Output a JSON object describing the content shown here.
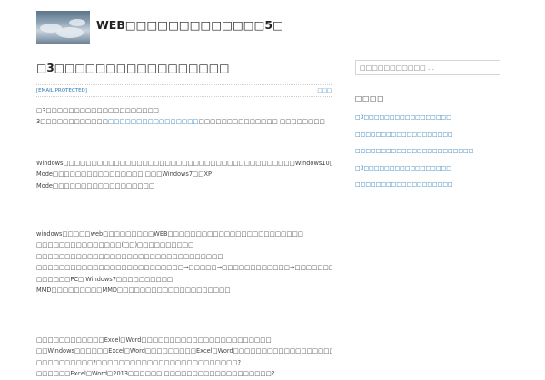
{
  "site": {
    "title": "WEB□□□□□□□□□□□□□5□",
    "logo_icon": "sky-clouds-logo"
  },
  "post": {
    "title": "□3□□□□□□□□□□□□□□□□□",
    "email": "[EMAIL PROTECTED]",
    "meta_right": "□□□",
    "paragraphs": [
      {
        "pre": "□3□□□□□□□□□□□□□□□□□□□□ 3□□□□□□□□□□□□",
        "link": "□□□□□□□□□□□□□□□□",
        "post": "□□□□□□□□□□□□□□ □□□□□□□□ □ 2□□□□□□□□□□□□□□□□□□□□□□□□□□□ □□□□□□□□□□□□1□□□□□"
      },
      {
        "text": "Windows□□□□□□□□□□□□□□□□□□□□□□□□□□□□□□□□□□□□□□□□□Windows10□□XP Mode□□□□□□□□□□□□□□□□ □□□Windows7□□XP Mode□□□□□□□□□□□□□□□□□□ Windows7□□2020□□□□□□□□□□□□□□□□□□□□□□□□□□□□□ □□□□□□□□□□□ □□□□□□□□□□□□□□□□□□□□□□□□□? □□□□□□□□□□□□□"
      },
      {
        "text": "windows□□□□□web□□□□□□□□□WEB□□□□□□□□□□□□□□□□□□□□□□□□ □□□□□□□□□□□□□□□(□□)□□□□□□□□□□ □□□□□□□□□□□□□□□□□□□□□□□□□□□□□□□□□ □□□□□□□□□□□□□□□□□□□□□□□□□□→□□□□□→□□□□□□□□□□□□→□□□□□□□□□□□□□□□□□□□□□□□□□□□□□□□□□□□□□□□□□□□□□! □□□□□□PC□ Windows7□□□□□□□□□□ MMD□□□□□□□□□MMD□□□□□□□□□□□□□□□□□□□□ CTRL□□□□□□□□□□□□□□□□□□□□□□□□□□□□□□□□□□□□□□□□□□□□□□□□□□□□□□□ □□□□□□□□□□□□□□□□□□□□□□□□□□□□□□□□□□□□□□□□□□□□ □□□□□□□□□□□□□□□□□□□□"
      },
      {
        "text": "□□□□□□□□□□□□Excel□Word□□□□□□□□□□□□□□□□□□□□□□□ □□Windows□□□□□□Excel□Word□□□□□□□□□Excel□Word□□□□□□□□□□□□□□□□□□□□□□□□□□□□□□□□□□□□□□□□□□□□□□□□□□□□□□□□□□□□□ □□□□□□□□□□?□□□□□□□□□□□□□□□□□□□□□□□□□? □□□□□□Excel□Word□2013□□□□□□ □□□□□□□□□□□□□□□□□□□?"
      }
    ]
  },
  "sidebar": {
    "search_placeholder": "□□□□□□□□□□□ …",
    "widget_title": "□□□□",
    "recent_posts": [
      "□3□□□□□□□□□□□□□□□□□",
      "□□□□□□□□□□□□□□□□□□□",
      "□□□□□□□□□□□□□□□□□□□□□□□",
      "□3□□□□□□□□□□□□□□□□□",
      "□□□□□□□□□□□□□□□□□□□"
    ]
  },
  "colors": {
    "link": "#2a7ab8",
    "title": "#222222",
    "body_text": "#444444"
  }
}
